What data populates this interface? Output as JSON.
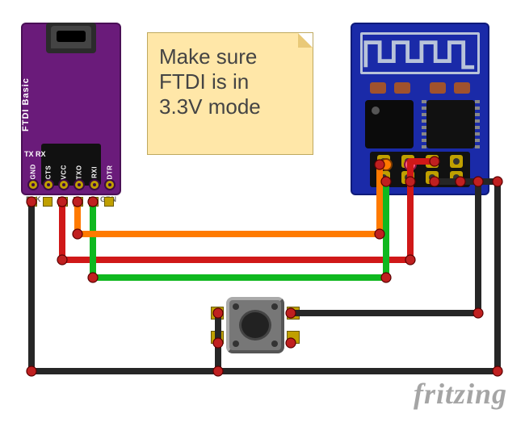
{
  "attribution": "fritzing",
  "note": {
    "line1": "Make sure",
    "line2": "FTDI is in",
    "line3": "3.3V mode"
  },
  "ftdi": {
    "board_label": "FTDI Basic",
    "txrx_label": "TX RX",
    "left_edge": "BLK",
    "right_edge": "GRN",
    "pins": [
      "GND",
      "CTS",
      "VCC",
      "TXO",
      "RXI",
      "DTR"
    ]
  },
  "esp8266": {
    "name": "ESP8266",
    "pin_rows": 2,
    "pin_cols": 4
  },
  "pushbutton": {
    "name": "Tactile Pushbutton"
  },
  "wires": [
    {
      "color": "black",
      "from": "FTDI GND",
      "to": "ESP8266 GND / Button"
    },
    {
      "color": "red",
      "from": "FTDI VCC",
      "to": "ESP8266 VCC / CH_PD"
    },
    {
      "color": "orange",
      "from": "FTDI TXO",
      "to": "ESP8266 RX"
    },
    {
      "color": "green",
      "from": "FTDI RXI",
      "to": "ESP8266 TX"
    },
    {
      "color": "black",
      "from": "ESP8266 GPIO0",
      "to": "Pushbutton"
    }
  ],
  "colors": {
    "wire_black": "#262626",
    "wire_red": "#d01818",
    "wire_green": "#0fb81f",
    "wire_orange": "#ff7a00",
    "ftdi_board": "#6a1b7a",
    "esp_board": "#1a2aa8",
    "note_bg": "#ffe7a8"
  }
}
